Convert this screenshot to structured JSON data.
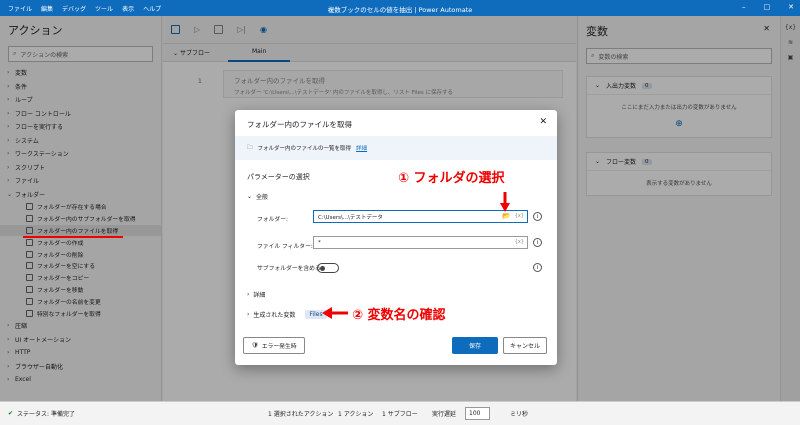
{
  "window": {
    "menu": [
      "ファイル",
      "編集",
      "デバッグ",
      "ツール",
      "表示",
      "ヘルプ"
    ],
    "title": "複数ブックのセルの値を抽出 | Power Automate",
    "controls": [
      "–",
      "□",
      "✕"
    ]
  },
  "left": {
    "title": "アクション",
    "search_placeholder": "アクションの検索",
    "cats_top": [
      "変数",
      "条件",
      "ループ",
      "フロー コントロール",
      "フローを実行する",
      "システム",
      "ワークステーション",
      "スクリプト",
      "ファイル"
    ],
    "folder_cat": "フォルダー",
    "folder_items": [
      "フォルダーが存在する場合",
      "フォルダー内のサブフォルダーを取得",
      "フォルダー内のファイルを取得",
      "フォルダーの作成",
      "フォルダーの削除",
      "フォルダーを空にする",
      "フォルダーをコピー",
      "フォルダーを移動",
      "フォルダーの名前を変更",
      "特別なフォルダーを取得"
    ],
    "cats_bottom": [
      "圧縮",
      "UI オートメーション",
      "HTTP",
      "ブラウザー自動化",
      "Excel"
    ]
  },
  "editor": {
    "subflow_label": "サブフロー",
    "main_tab": "Main",
    "line_no": "1",
    "step_title": "フォルダー内のファイルを取得",
    "step_desc": "フォルダー 'C:\\Users\\...\\テストデータ' 内のファイルを取得し、リスト Files に保存する"
  },
  "right": {
    "title": "変数",
    "search_placeholder": "変数の検索",
    "io": {
      "label": "入出力変数",
      "count": "0",
      "msg": "ここにまだ入力または出力の変数がありません"
    },
    "flow": {
      "label": "フロー変数",
      "count": "0",
      "msg": "表示する変数がありません"
    },
    "rail": [
      "{x}",
      "≋",
      "▣"
    ]
  },
  "status": {
    "state": "ステータス: 準備完了",
    "selected": "1 選択されたアクション",
    "actions": "1 アクション",
    "subflows": "1 サブフロー",
    "delay_label": "実行遅延",
    "delay_value": "100",
    "unit": "ミリ秒"
  },
  "dialog": {
    "title": "フォルダー内のファイルを取得",
    "info": "フォルダー内のファイルの一覧を取得",
    "info_link": "詳細",
    "params_heading": "パラメーターの選択",
    "general": "全般",
    "folder_label": "フォルダー:",
    "folder_value": "C:\\Users\\...\\テストデータ",
    "filter_label": "ファイル フィルター:",
    "filter_value": "*",
    "subfolder_label": "サブフォルダーを含める:",
    "details": "詳細",
    "generated_vars": "生成された変数",
    "files_var": "Files",
    "error_btn": "エラー発生時",
    "save_btn": "保存",
    "cancel_btn": "キャンセル",
    "fx": "{x}"
  },
  "annotations": {
    "one": "① フォルダの選択",
    "two": "② 変数名の確認",
    "color": "#e00000"
  }
}
